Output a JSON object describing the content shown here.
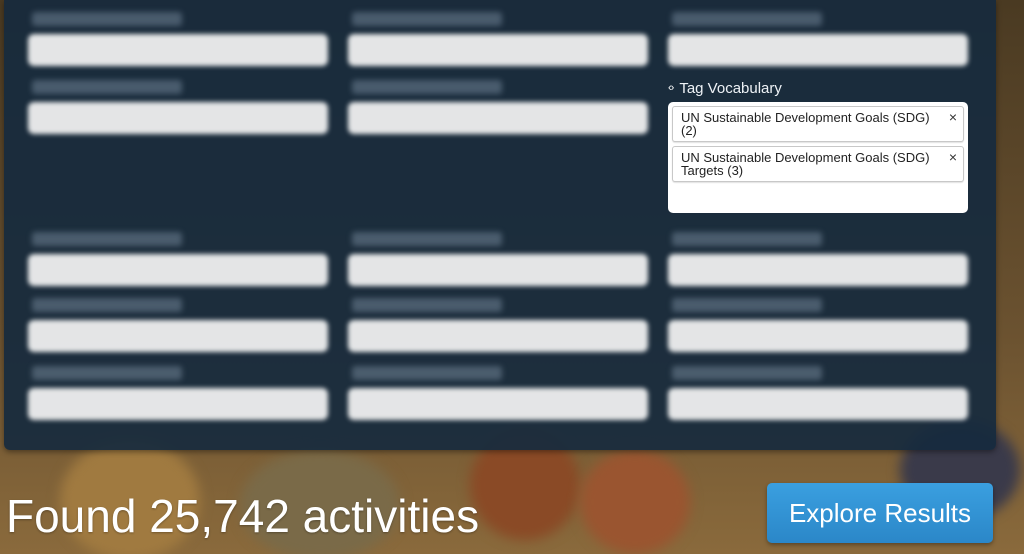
{
  "tag_vocabulary": {
    "label": "Tag Vocabulary",
    "icon": "expand-collapse-icon",
    "selected": [
      {
        "text": "UN Sustainable Development Goals (SDG) (2)",
        "remove": "×"
      },
      {
        "text": "UN Sustainable Development Goals (SDG) Targets (3)",
        "remove": "×"
      }
    ]
  },
  "results": {
    "summary": "Found 25,742 activities",
    "button_label": "Explore Results"
  },
  "colors": {
    "panel": "#162a3e",
    "button": "#2b87c8",
    "chip_border": "#c8c8c8"
  }
}
